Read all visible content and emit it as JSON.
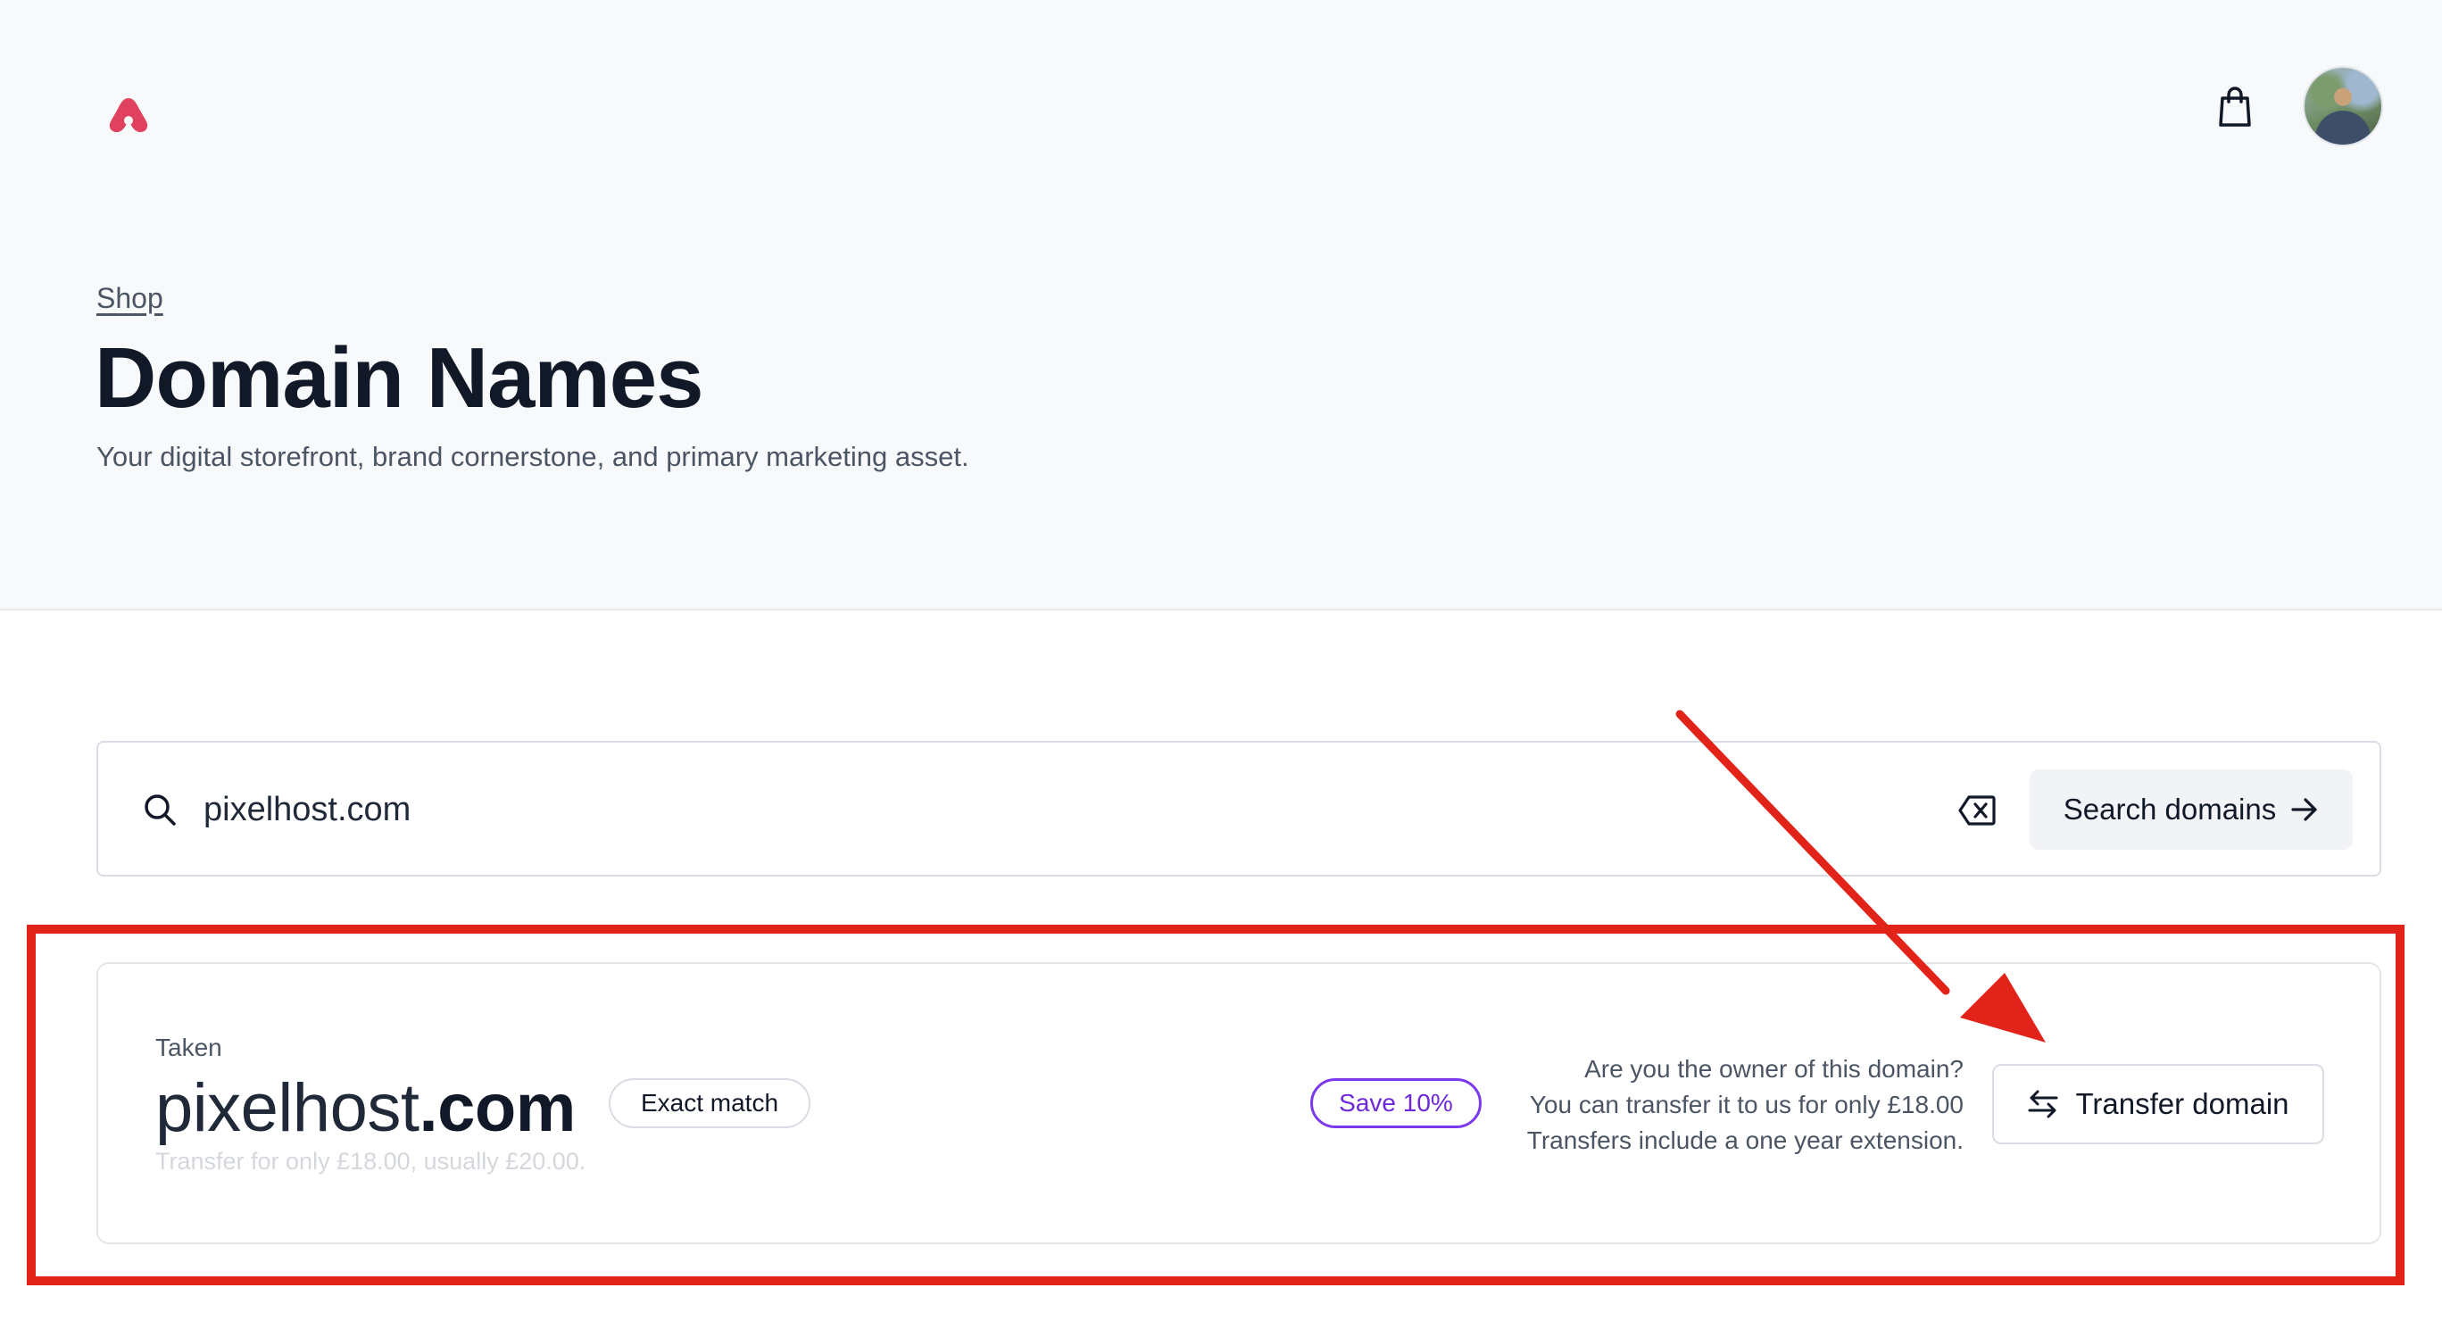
{
  "header": {
    "logo_icon": "brand-logo-icon",
    "cart_icon": "shopping-bag-icon",
    "avatar": "user-avatar"
  },
  "breadcrumb": "Shop",
  "page": {
    "title": "Domain Names",
    "subtitle": "Your digital storefront, brand cornerstone, and primary marketing asset."
  },
  "search": {
    "value": "pixelhost.com",
    "button_label": "Search domains",
    "icons": [
      "search-icon",
      "clear-input-icon",
      "arrow-right-icon"
    ]
  },
  "result": {
    "status": "Taken",
    "domain_name": "pixelhost",
    "domain_tld": ".com",
    "match_badge": "Exact match",
    "price_note": "Transfer for only £18.00, usually £20.00.",
    "save_badge": "Save 10%",
    "owner_question": "Are you the owner of this domain?",
    "owner_line2": "You can transfer it to us for only £18.00",
    "owner_line3": "Transfers include a one year extension.",
    "transfer_button": "Transfer domain",
    "transfer_icon": "swap-arrows-icon"
  },
  "colors": {
    "brand": "#e0415f",
    "save_badge": "#7c3aed",
    "annotation": "#e2231a",
    "hero_bg": "#f8f9fb"
  }
}
